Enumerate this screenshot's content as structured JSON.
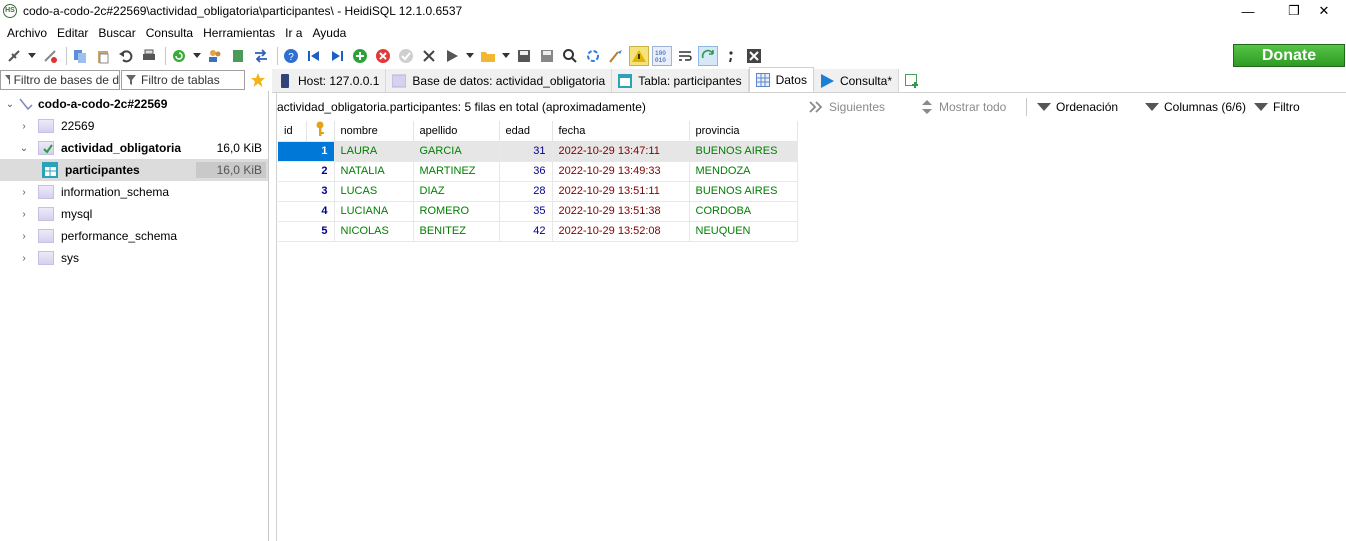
{
  "window": {
    "app_icon_text": "HS",
    "title": "codo-a-codo-2c#22569\\actividad_obligatoria\\participantes\\ - HeidiSQL 12.1.0.6537",
    "minimize": "—",
    "maximize": "❐",
    "close": "✕"
  },
  "menu": [
    "Archivo",
    "Editar",
    "Buscar",
    "Consulta",
    "Herramientas",
    "Ir a",
    "Ayuda"
  ],
  "toolbar": {
    "donate_label": "Donate"
  },
  "filters": {
    "db_filter_placeholder": "Filtro de bases de d",
    "table_filter_placeholder": "Filtro de tablas"
  },
  "tabs": [
    {
      "label": "Host: 127.0.0.1"
    },
    {
      "label": "Base de datos: actividad_obligatoria"
    },
    {
      "label": "Tabla: participantes"
    },
    {
      "label": "Datos"
    },
    {
      "label": "Consulta*"
    }
  ],
  "tree": {
    "root": {
      "label": "codo-a-codo-2c#22569"
    },
    "items": [
      {
        "label": "22569",
        "size": ""
      },
      {
        "label": "actividad_obligatoria",
        "size": "16,0 KiB"
      },
      {
        "label": "participantes",
        "size": "16,0 KiB"
      },
      {
        "label": "information_schema",
        "size": ""
      },
      {
        "label": "mysql",
        "size": ""
      },
      {
        "label": "performance_schema",
        "size": ""
      },
      {
        "label": "sys",
        "size": ""
      }
    ]
  },
  "infobar": {
    "summary": "actividad_obligatoria.participantes: 5 filas en total (aproximadamente)",
    "next": "Siguientes",
    "show_all": "Mostrar todo",
    "sort": "Ordenación",
    "columns": "Columnas (6/6)",
    "filter": "Filtro"
  },
  "grid": {
    "headers": [
      "id",
      "nombre",
      "apellido",
      "edad",
      "fecha",
      "provincia"
    ],
    "rows": [
      [
        "1",
        "LAURA",
        "GARCIA",
        "31",
        "2022-10-29 13:47:11",
        "BUENOS AIRES"
      ],
      [
        "2",
        "NATALIA",
        "MARTINEZ",
        "36",
        "2022-10-29 13:49:33",
        "MENDOZA"
      ],
      [
        "3",
        "LUCAS",
        "DIAZ",
        "28",
        "2022-10-29 13:51:11",
        "BUENOS AIRES"
      ],
      [
        "4",
        "LUCIANA",
        "ROMERO",
        "35",
        "2022-10-29 13:51:38",
        "CORDOBA"
      ],
      [
        "5",
        "NICOLAS",
        "BENITEZ",
        "42",
        "2022-10-29 13:52:08",
        "NEUQUEN"
      ]
    ]
  },
  "colors": {
    "accent": "#0078d7",
    "donate": "#3aa92c",
    "id_text": "#00008b",
    "text_values": "#008000",
    "date_values": "#800000"
  }
}
